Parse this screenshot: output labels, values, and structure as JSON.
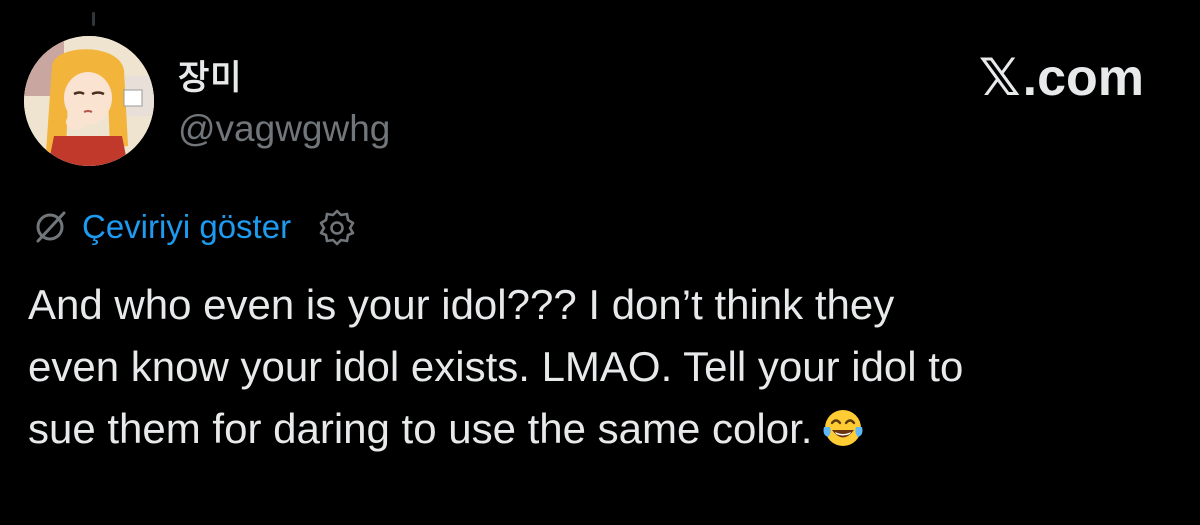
{
  "author": {
    "display_name": "장미",
    "handle": "@vagwgwhg",
    "avatar_icon": "anime-girl-avatar"
  },
  "brand": {
    "name": "X.com",
    "glyph": "𝕏",
    "suffix": ".com",
    "icon": "x-logo-icon"
  },
  "translation": {
    "label": "Çeviriyi göster",
    "icon": "no-translation-icon",
    "settings_icon": "gear-icon"
  },
  "tweet": {
    "lines": [
      "And who even is your idol??? I don’t think they",
      "even know your idol exists. LMAO. Tell your idol to",
      "sue them for daring to use the same color."
    ],
    "emoji": "face-with-tears-of-joy"
  },
  "colors": {
    "background": "#000000",
    "text_primary": "#e7e9ea",
    "text_secondary": "#71767b",
    "link": "#1d9bf0"
  }
}
